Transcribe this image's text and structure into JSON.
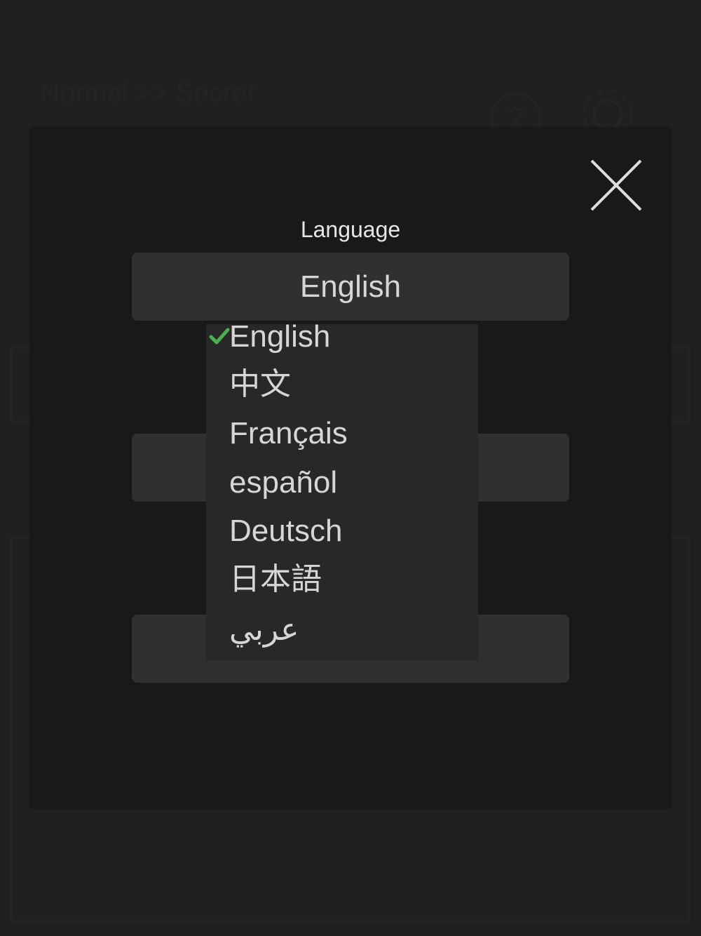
{
  "background": {
    "title": "Normal >> Secret",
    "help_glyph": "?"
  },
  "modal": {
    "language_label": "Language",
    "selected_language": "English"
  },
  "dropdown": {
    "options": [
      {
        "label": "English",
        "selected": true
      },
      {
        "label": "中文",
        "selected": false
      },
      {
        "label": "Français",
        "selected": false
      },
      {
        "label": "español",
        "selected": false
      },
      {
        "label": "Deutsch",
        "selected": false
      },
      {
        "label": "日本語",
        "selected": false
      },
      {
        "label": "عربي",
        "selected": false
      }
    ]
  },
  "colors": {
    "background": "#202020",
    "modal": "#191919",
    "field": "#303030",
    "dropdown": "#282828",
    "check": "#4caf50",
    "text": "#d6d6d6"
  },
  "icons": {
    "close": "close-icon",
    "check": "check-icon",
    "help": "help-icon",
    "settings": "gear-icon"
  }
}
